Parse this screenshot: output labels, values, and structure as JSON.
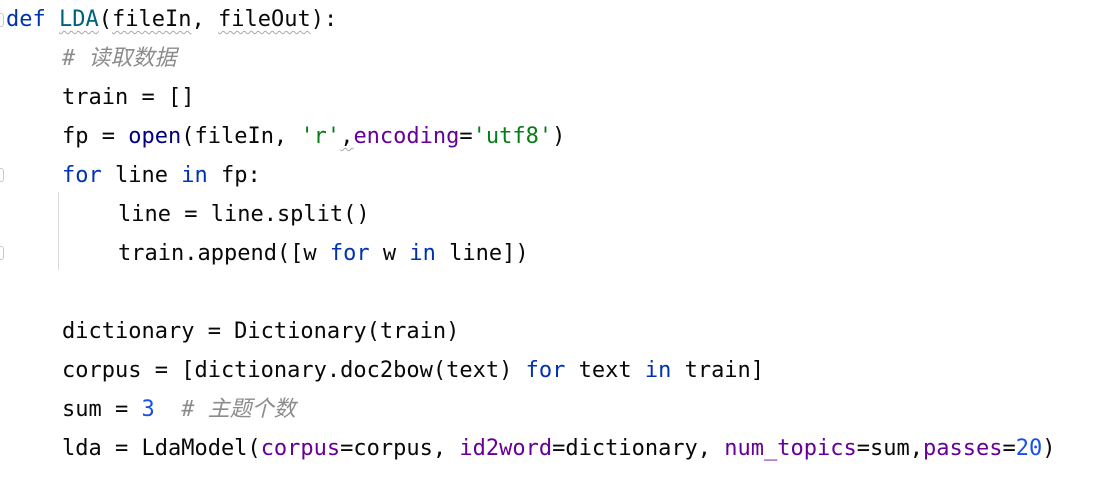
{
  "editor": {
    "lines": [
      {
        "parts": [
          "def",
          " ",
          "LDA",
          "(",
          "fileIn",
          ", ",
          "fileOut",
          "):"
        ]
      },
      {
        "parts": [
          "# ",
          "读取数据"
        ]
      },
      {
        "parts": [
          "train = []"
        ]
      },
      {
        "parts": [
          "fp = ",
          "open",
          "(fileIn, ",
          "'r'",
          ",",
          "encoding",
          "=",
          "'utf8'",
          ")"
        ]
      },
      {
        "parts": [
          "for",
          " line ",
          "in",
          " fp:"
        ]
      },
      {
        "parts": [
          "line = line.split()"
        ]
      },
      {
        "parts": [
          "train.append([w ",
          "for",
          " w ",
          "in",
          " line])"
        ]
      },
      {
        "parts": [
          ""
        ]
      },
      {
        "parts": [
          "dictionary = Dictionary(train)"
        ]
      },
      {
        "parts": [
          "corpus = [dictionary.doc2bow(text) ",
          "for",
          " text ",
          "in",
          " train]"
        ]
      },
      {
        "parts": [
          "sum = ",
          "3",
          "  ",
          "# 主题个数"
        ]
      },
      {
        "parts": [
          "lda = LdaModel(",
          "corpus",
          "=corpus, ",
          "id2word",
          "=dictionary, ",
          "num_topics",
          "=sum,",
          "passes",
          "=",
          "20",
          ")"
        ]
      }
    ]
  }
}
